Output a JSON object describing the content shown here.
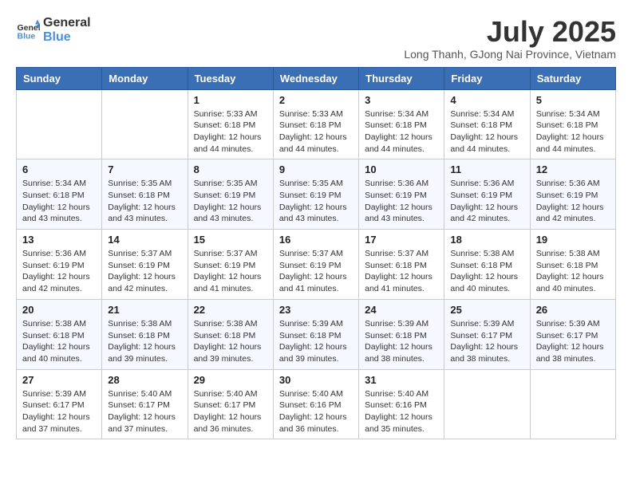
{
  "header": {
    "logo_line1": "General",
    "logo_line2": "Blue",
    "month": "July 2025",
    "location": "Long Thanh, GJong Nai Province, Vietnam"
  },
  "weekdays": [
    "Sunday",
    "Monday",
    "Tuesday",
    "Wednesday",
    "Thursday",
    "Friday",
    "Saturday"
  ],
  "weeks": [
    [
      {
        "day": "",
        "info": ""
      },
      {
        "day": "",
        "info": ""
      },
      {
        "day": "1",
        "info": "Sunrise: 5:33 AM\nSunset: 6:18 PM\nDaylight: 12 hours and 44 minutes."
      },
      {
        "day": "2",
        "info": "Sunrise: 5:33 AM\nSunset: 6:18 PM\nDaylight: 12 hours and 44 minutes."
      },
      {
        "day": "3",
        "info": "Sunrise: 5:34 AM\nSunset: 6:18 PM\nDaylight: 12 hours and 44 minutes."
      },
      {
        "day": "4",
        "info": "Sunrise: 5:34 AM\nSunset: 6:18 PM\nDaylight: 12 hours and 44 minutes."
      },
      {
        "day": "5",
        "info": "Sunrise: 5:34 AM\nSunset: 6:18 PM\nDaylight: 12 hours and 44 minutes."
      }
    ],
    [
      {
        "day": "6",
        "info": "Sunrise: 5:34 AM\nSunset: 6:18 PM\nDaylight: 12 hours and 43 minutes."
      },
      {
        "day": "7",
        "info": "Sunrise: 5:35 AM\nSunset: 6:18 PM\nDaylight: 12 hours and 43 minutes."
      },
      {
        "day": "8",
        "info": "Sunrise: 5:35 AM\nSunset: 6:19 PM\nDaylight: 12 hours and 43 minutes."
      },
      {
        "day": "9",
        "info": "Sunrise: 5:35 AM\nSunset: 6:19 PM\nDaylight: 12 hours and 43 minutes."
      },
      {
        "day": "10",
        "info": "Sunrise: 5:36 AM\nSunset: 6:19 PM\nDaylight: 12 hours and 43 minutes."
      },
      {
        "day": "11",
        "info": "Sunrise: 5:36 AM\nSunset: 6:19 PM\nDaylight: 12 hours and 42 minutes."
      },
      {
        "day": "12",
        "info": "Sunrise: 5:36 AM\nSunset: 6:19 PM\nDaylight: 12 hours and 42 minutes."
      }
    ],
    [
      {
        "day": "13",
        "info": "Sunrise: 5:36 AM\nSunset: 6:19 PM\nDaylight: 12 hours and 42 minutes."
      },
      {
        "day": "14",
        "info": "Sunrise: 5:37 AM\nSunset: 6:19 PM\nDaylight: 12 hours and 42 minutes."
      },
      {
        "day": "15",
        "info": "Sunrise: 5:37 AM\nSunset: 6:19 PM\nDaylight: 12 hours and 41 minutes."
      },
      {
        "day": "16",
        "info": "Sunrise: 5:37 AM\nSunset: 6:19 PM\nDaylight: 12 hours and 41 minutes."
      },
      {
        "day": "17",
        "info": "Sunrise: 5:37 AM\nSunset: 6:18 PM\nDaylight: 12 hours and 41 minutes."
      },
      {
        "day": "18",
        "info": "Sunrise: 5:38 AM\nSunset: 6:18 PM\nDaylight: 12 hours and 40 minutes."
      },
      {
        "day": "19",
        "info": "Sunrise: 5:38 AM\nSunset: 6:18 PM\nDaylight: 12 hours and 40 minutes."
      }
    ],
    [
      {
        "day": "20",
        "info": "Sunrise: 5:38 AM\nSunset: 6:18 PM\nDaylight: 12 hours and 40 minutes."
      },
      {
        "day": "21",
        "info": "Sunrise: 5:38 AM\nSunset: 6:18 PM\nDaylight: 12 hours and 39 minutes."
      },
      {
        "day": "22",
        "info": "Sunrise: 5:38 AM\nSunset: 6:18 PM\nDaylight: 12 hours and 39 minutes."
      },
      {
        "day": "23",
        "info": "Sunrise: 5:39 AM\nSunset: 6:18 PM\nDaylight: 12 hours and 39 minutes."
      },
      {
        "day": "24",
        "info": "Sunrise: 5:39 AM\nSunset: 6:18 PM\nDaylight: 12 hours and 38 minutes."
      },
      {
        "day": "25",
        "info": "Sunrise: 5:39 AM\nSunset: 6:17 PM\nDaylight: 12 hours and 38 minutes."
      },
      {
        "day": "26",
        "info": "Sunrise: 5:39 AM\nSunset: 6:17 PM\nDaylight: 12 hours and 38 minutes."
      }
    ],
    [
      {
        "day": "27",
        "info": "Sunrise: 5:39 AM\nSunset: 6:17 PM\nDaylight: 12 hours and 37 minutes."
      },
      {
        "day": "28",
        "info": "Sunrise: 5:40 AM\nSunset: 6:17 PM\nDaylight: 12 hours and 37 minutes."
      },
      {
        "day": "29",
        "info": "Sunrise: 5:40 AM\nSunset: 6:17 PM\nDaylight: 12 hours and 36 minutes."
      },
      {
        "day": "30",
        "info": "Sunrise: 5:40 AM\nSunset: 6:16 PM\nDaylight: 12 hours and 36 minutes."
      },
      {
        "day": "31",
        "info": "Sunrise: 5:40 AM\nSunset: 6:16 PM\nDaylight: 12 hours and 35 minutes."
      },
      {
        "day": "",
        "info": ""
      },
      {
        "day": "",
        "info": ""
      }
    ]
  ]
}
